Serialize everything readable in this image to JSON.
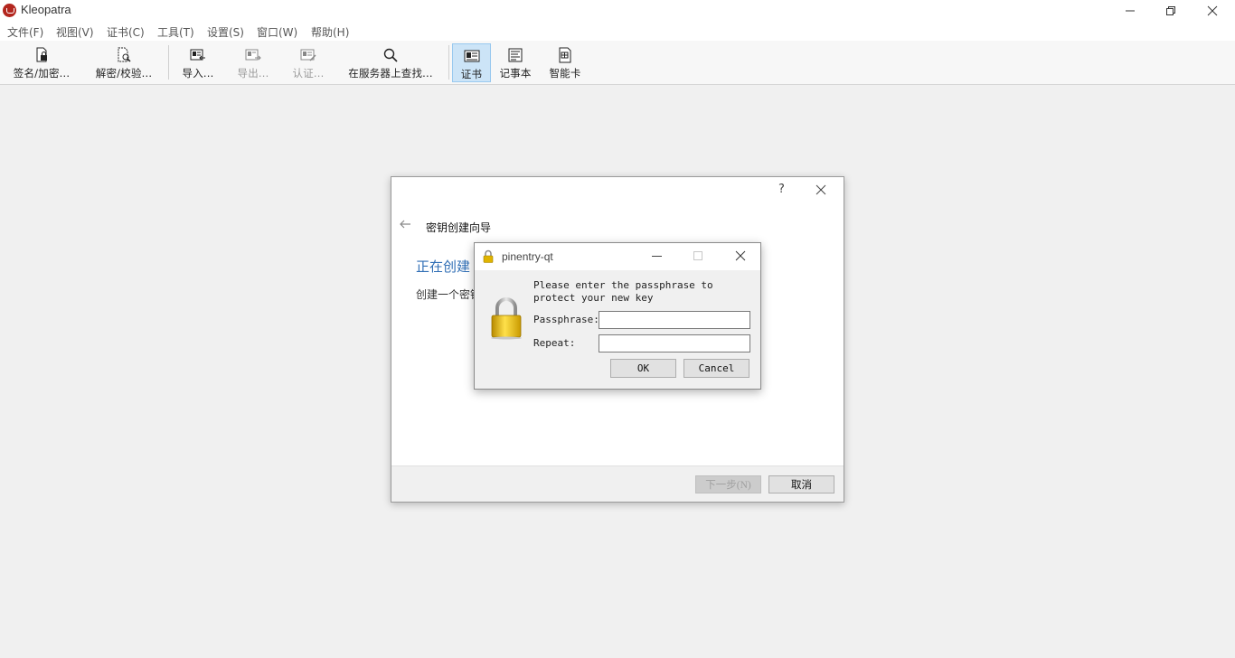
{
  "window": {
    "title": "Kleopatra"
  },
  "menu": [
    "文件(F)",
    "视图(V)",
    "证书(C)",
    "工具(T)",
    "设置(S)",
    "窗口(W)",
    "帮助(H)"
  ],
  "toolbar": {
    "sign_encrypt": "签名/加密...",
    "decrypt_verify": "解密/校验...",
    "import": "导入...",
    "export": "导出...",
    "certify": "认证...",
    "lookup_server": "在服务器上查找...",
    "certificates": "证书",
    "notepad": "记事本",
    "smartcards": "智能卡"
  },
  "wizard": {
    "help": "?",
    "title": "密钥创建向导",
    "heading": "正在创建",
    "description": "创建一个密钥",
    "next_button": "下一步(N)",
    "cancel_button": "取消"
  },
  "pinentry": {
    "title": "pinentry-qt",
    "message": "Please enter the passphrase to\nprotect your new key",
    "passphrase_label": "Passphrase:",
    "repeat_label": "Repeat:",
    "passphrase_value": "",
    "repeat_value": "",
    "ok_button": "OK",
    "cancel_button": "Cancel"
  }
}
